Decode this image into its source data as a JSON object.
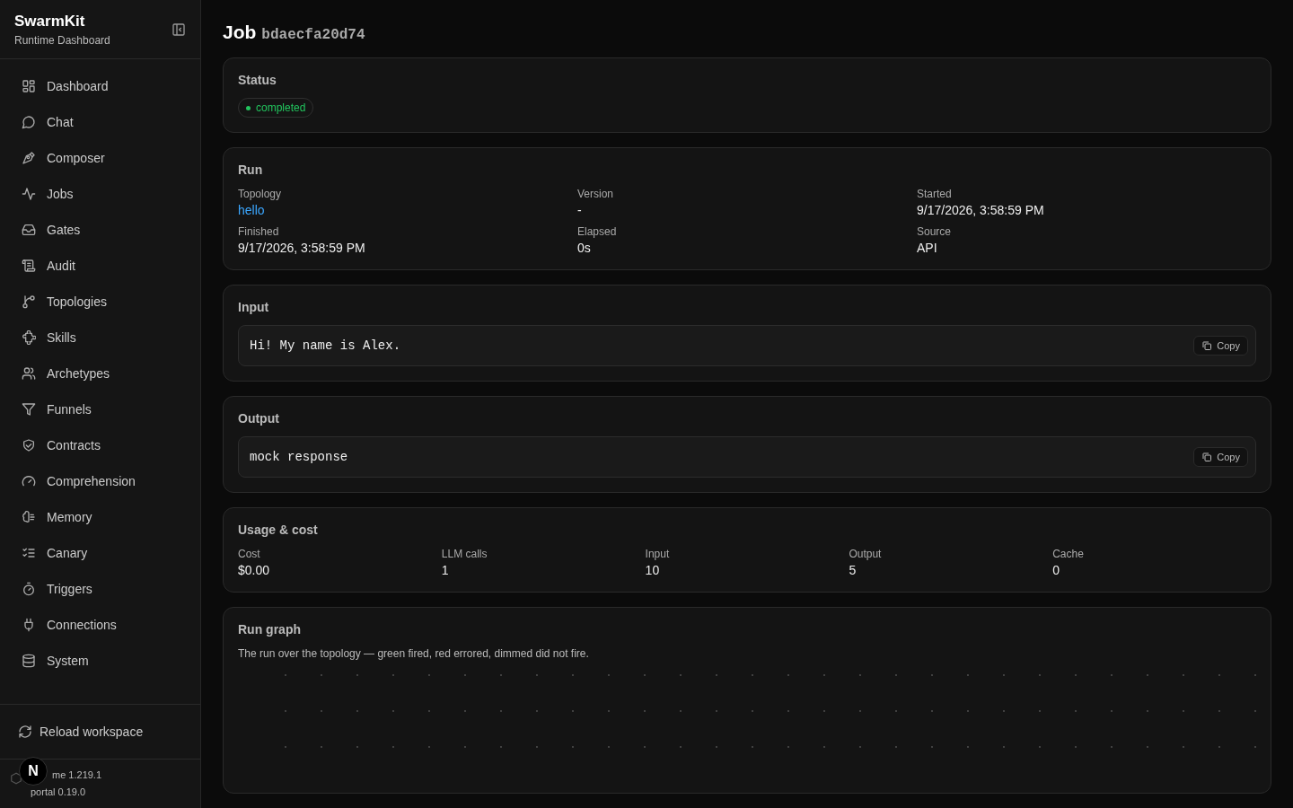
{
  "sidebar": {
    "brand": "SwarmKit",
    "subtitle": "Runtime Dashboard",
    "items": [
      {
        "label": "Dashboard",
        "selected": false
      },
      {
        "label": "Chat",
        "selected": false
      },
      {
        "label": "Composer",
        "selected": false
      },
      {
        "label": "Jobs",
        "selected": false
      },
      {
        "label": "Gates",
        "selected": false
      },
      {
        "label": "Audit",
        "selected": false
      },
      {
        "label": "Topologies",
        "selected": false
      },
      {
        "label": "Skills",
        "selected": false
      },
      {
        "label": "Archetypes",
        "selected": false
      },
      {
        "label": "Funnels",
        "selected": false
      },
      {
        "label": "Contracts",
        "selected": false
      },
      {
        "label": "Comprehension",
        "selected": false
      },
      {
        "label": "Memory",
        "selected": false
      },
      {
        "label": "Canary",
        "selected": false
      },
      {
        "label": "Triggers",
        "selected": false
      },
      {
        "label": "Connections",
        "selected": false
      },
      {
        "label": "System",
        "selected": false
      }
    ],
    "reload": "Reload workspace",
    "version_runtime": "me 1.219.1",
    "version_portal": "portal 0.19.0",
    "badge": "N"
  },
  "page": {
    "title": "Job",
    "job_id": "bdaecfa20d74"
  },
  "status": {
    "heading": "Status",
    "badge": "completed",
    "color": "#22c55e"
  },
  "run": {
    "heading": "Run",
    "fields": [
      {
        "label": "Topology",
        "value": "hello",
        "kind": "link"
      },
      {
        "label": "Version",
        "value": "-",
        "kind": "text"
      },
      {
        "label": "Started",
        "value": "9/17/2026, 3:58:59 PM",
        "kind": "text"
      },
      {
        "label": "Finished",
        "value": "9/17/2026, 3:58:59 PM",
        "kind": "text"
      },
      {
        "label": "Elapsed",
        "value": "0s",
        "kind": "text"
      },
      {
        "label": "Source",
        "value": "API",
        "kind": "text"
      }
    ]
  },
  "input": {
    "heading": "Input",
    "value": "Hi! My name is Alex.",
    "copy": "Copy"
  },
  "output": {
    "heading": "Output",
    "value": "mock response",
    "copy": "Copy"
  },
  "usage": {
    "heading": "Usage & cost",
    "fields": [
      {
        "label": "Cost",
        "value": "$0.00"
      },
      {
        "label": "LLM calls",
        "value": "1"
      },
      {
        "label": "Input",
        "value": "10"
      },
      {
        "label": "Output",
        "value": "5"
      },
      {
        "label": "Cache",
        "value": "0"
      }
    ]
  },
  "graph": {
    "heading": "Run graph",
    "description": "The run over the topology — green fired, red errored, dimmed did not fire."
  }
}
